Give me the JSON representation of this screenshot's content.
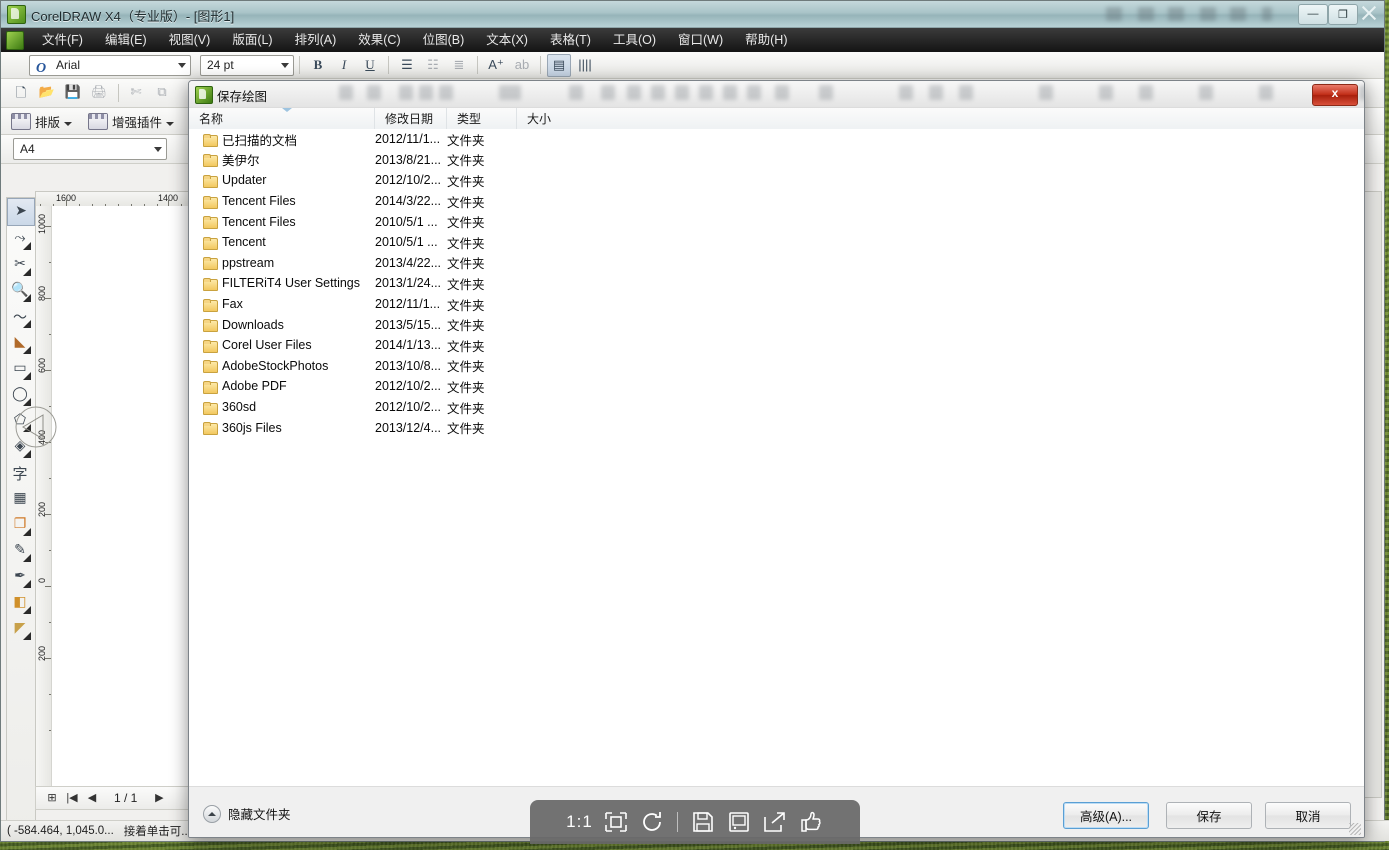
{
  "app": {
    "title": "CorelDRAW X4（专业版）- [图形1]",
    "window_buttons": {
      "minimize": "—",
      "maximize": "❐",
      "close": "✕"
    },
    "menu": [
      {
        "label": "文件(F)"
      },
      {
        "label": "编辑(E)"
      },
      {
        "label": "视图(V)"
      },
      {
        "label": "版面(L)"
      },
      {
        "label": "排列(A)"
      },
      {
        "label": "效果(C)"
      },
      {
        "label": "位图(B)"
      },
      {
        "label": "文本(X)"
      },
      {
        "label": "表格(T)"
      },
      {
        "label": "工具(O)"
      },
      {
        "label": "窗口(W)"
      },
      {
        "label": "帮助(H)"
      }
    ],
    "text_toolbar": {
      "font_value": "Arial",
      "size_value": "24 pt",
      "bold": "B",
      "italic": "I",
      "underline": "U"
    },
    "plugin_toolbar": [
      {
        "label": "排版"
      },
      {
        "label": "增强插件"
      }
    ],
    "page_toolbar": {
      "paper_value": "A4"
    },
    "rulers": {
      "horizontal_labels": [
        "1600",
        "1400"
      ],
      "vertical_labels": [
        "1000",
        "800",
        "600",
        "400",
        "200",
        "0",
        "200"
      ]
    },
    "page_nav": {
      "first": "|◀",
      "prev": "◀",
      "count": "1 / 1",
      "next": "▶"
    },
    "status": {
      "coords": "( -584.464, 1,045.0...",
      "hint": "接着单击可..."
    }
  },
  "dialog": {
    "title": "保存绘图",
    "close_label": "x",
    "columns": [
      {
        "key": "name",
        "label": "名称",
        "sorted": true
      },
      {
        "key": "date",
        "label": "修改日期"
      },
      {
        "key": "type",
        "label": "类型"
      },
      {
        "key": "size",
        "label": "大小"
      }
    ],
    "rows": [
      {
        "name": "已扫描的文档",
        "date": "2012/11/1...",
        "type": "文件夹",
        "size": ""
      },
      {
        "name": "美伊尔",
        "date": "2013/8/21...",
        "type": "文件夹",
        "size": ""
      },
      {
        "name": "Updater",
        "date": "2012/10/2...",
        "type": "文件夹",
        "size": ""
      },
      {
        "name": "Tencent Files",
        "date": "2014/3/22...",
        "type": "文件夹",
        "size": ""
      },
      {
        "name": "Tencent Files",
        "date": "2010/5/1 ...",
        "type": "文件夹",
        "size": ""
      },
      {
        "name": "Tencent",
        "date": "2010/5/1 ...",
        "type": "文件夹",
        "size": ""
      },
      {
        "name": "ppstream",
        "date": "2013/4/22...",
        "type": "文件夹",
        "size": ""
      },
      {
        "name": "FILTERiT4 User Settings",
        "date": "2013/1/24...",
        "type": "文件夹",
        "size": ""
      },
      {
        "name": "Fax",
        "date": "2012/11/1...",
        "type": "文件夹",
        "size": ""
      },
      {
        "name": "Downloads",
        "date": "2013/5/15...",
        "type": "文件夹",
        "size": ""
      },
      {
        "name": "Corel User Files",
        "date": "2014/1/13...",
        "type": "文件夹",
        "size": ""
      },
      {
        "name": "AdobeStockPhotos",
        "date": "2013/10/8...",
        "type": "文件夹",
        "size": ""
      },
      {
        "name": "Adobe PDF",
        "date": "2012/10/2...",
        "type": "文件夹",
        "size": ""
      },
      {
        "name": "360sd",
        "date": "2012/10/2...",
        "type": "文件夹",
        "size": ""
      },
      {
        "name": "360js Files",
        "date": "2013/12/4...",
        "type": "文件夹",
        "size": ""
      }
    ],
    "footer": {
      "hide_folders": "隐藏文件夹",
      "advanced": "高级(A)...",
      "save": "保存",
      "cancel": "取消"
    }
  },
  "capture_toolbar": {
    "ratio": "1:1",
    "buttons": [
      "1:1",
      "fit-screen-icon",
      "refresh-icon",
      "save-icon",
      "monitor-icon",
      "share-icon",
      "thumbs-up-icon"
    ]
  },
  "colors": {
    "title_bar": "#a9c4c8",
    "menu_bar": "#222222",
    "dialog_bg": "#f0f0f0",
    "close_red": "#c22e18",
    "desktop_green": "#52682a",
    "folder_yellow": "#f3c85f"
  }
}
